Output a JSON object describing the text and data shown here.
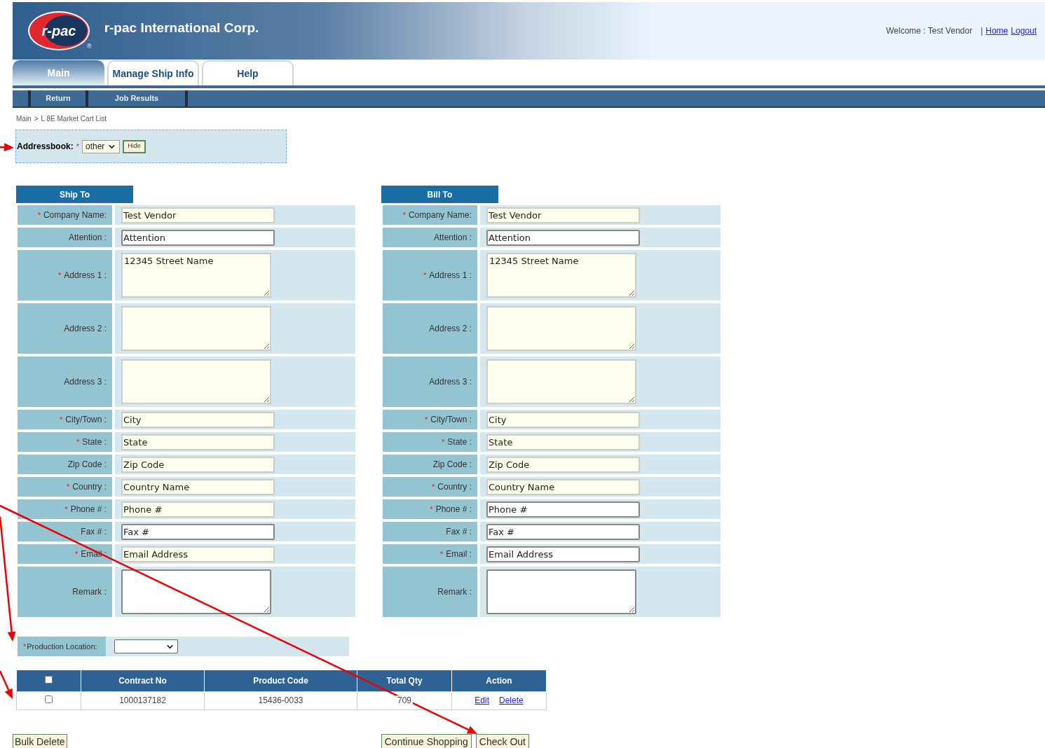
{
  "required_mark": "*",
  "header": {
    "company": "r-pac International Corp.",
    "logo_text": "r-pac",
    "registered": "®",
    "welcome": "Welcome : Test Vendor",
    "separator": "|",
    "links": [
      "Home",
      "Logout"
    ]
  },
  "tabs": [
    {
      "label": "Main",
      "selected": true
    },
    {
      "label": "Manage Ship Info",
      "selected": false
    },
    {
      "label": "Help",
      "selected": false
    }
  ],
  "subnav": [
    "Return",
    "Job Results"
  ],
  "breadcrumb": {
    "items": [
      "Main",
      "L 8E Market Cart List"
    ],
    "separator": ">"
  },
  "addressbook": {
    "label": "Addressbook:",
    "required": true,
    "value": "other",
    "button": "Hide"
  },
  "sections": [
    {
      "title": "Ship To",
      "fields": [
        {
          "label": "Company Name:",
          "required": true,
          "kind": "input",
          "highlighted": true,
          "value": "Test Vendor"
        },
        {
          "label": "Attention :",
          "required": false,
          "kind": "input",
          "highlighted": false,
          "value": "Attention"
        },
        {
          "label": "Address 1 :",
          "required": true,
          "kind": "textarea",
          "highlighted": true,
          "value": "12345 Street Name"
        },
        {
          "label": "Address 2 :",
          "required": false,
          "kind": "textarea",
          "highlighted": true
        },
        {
          "label": "Address 3 :",
          "required": false,
          "kind": "textarea",
          "highlighted": true
        },
        {
          "label": "City/Town :",
          "required": true,
          "kind": "input",
          "highlighted": true,
          "value": "City"
        },
        {
          "label": "State :",
          "required": true,
          "kind": "input",
          "highlighted": true,
          "value": "State"
        },
        {
          "label": "Zip Code :",
          "required": false,
          "kind": "input",
          "highlighted": true,
          "value": "Zip Code"
        },
        {
          "label": "Country :",
          "required": true,
          "kind": "input",
          "highlighted": true,
          "value": "Country Name"
        },
        {
          "label": "Phone # :",
          "required": true,
          "kind": "input",
          "highlighted": true,
          "value": "Phone #"
        },
        {
          "label": "Fax # :",
          "required": false,
          "kind": "input",
          "highlighted": false,
          "value": "Fax #"
        },
        {
          "label": "Email :",
          "required": true,
          "kind": "input",
          "highlighted": true,
          "value": "Email Address"
        },
        {
          "label": "Remark :",
          "required": false,
          "kind": "textarea",
          "highlighted": false
        }
      ]
    },
    {
      "title": "Bill To",
      "fields": [
        {
          "label": "Company Name:",
          "required": true,
          "kind": "input",
          "highlighted": true,
          "value": "Test Vendor"
        },
        {
          "label": "Attention :",
          "required": false,
          "kind": "input",
          "highlighted": false,
          "value": "Attention"
        },
        {
          "label": "Address 1 :",
          "required": true,
          "kind": "textarea",
          "highlighted": true,
          "value": "12345 Street Name"
        },
        {
          "label": "Address 2 :",
          "required": false,
          "kind": "textarea",
          "highlighted": true
        },
        {
          "label": "Address 3 :",
          "required": false,
          "kind": "textarea",
          "highlighted": true
        },
        {
          "label": "City/Town :",
          "required": true,
          "kind": "input",
          "highlighted": true,
          "value": "City"
        },
        {
          "label": "State :",
          "required": true,
          "kind": "input",
          "highlighted": true,
          "value": "State"
        },
        {
          "label": "Zip Code :",
          "required": false,
          "kind": "input",
          "highlighted": true,
          "value": "Zip Code"
        },
        {
          "label": "Country :",
          "required": true,
          "kind": "input",
          "highlighted": true,
          "value": "Country Name"
        },
        {
          "label": "Phone # :",
          "required": true,
          "kind": "input",
          "highlighted": false,
          "value": "Phone #"
        },
        {
          "label": "Fax # :",
          "required": false,
          "kind": "input",
          "highlighted": false,
          "value": "Fax #"
        },
        {
          "label": "Email :",
          "required": true,
          "kind": "input",
          "highlighted": false,
          "value": "Email Address"
        },
        {
          "label": "Remark :",
          "required": false,
          "kind": "textarea",
          "highlighted": false
        }
      ]
    }
  ],
  "production_location": {
    "label": "Production Location:",
    "required": true
  },
  "table": {
    "header_checkbox": {
      "checked": false
    },
    "columns": [
      "Contract No",
      "Product Code",
      "Total Qty",
      "Action"
    ],
    "rows": [
      {
        "checked": false,
        "contract_no": "1000137182",
        "product_code": "15436-0033",
        "total_qty": "709",
        "actions": [
          "Edit",
          "Delete"
        ]
      }
    ]
  },
  "buttons": {
    "left": [
      "Bulk Delete"
    ],
    "right": [
      "Continue Shopping",
      "Check Out"
    ]
  }
}
